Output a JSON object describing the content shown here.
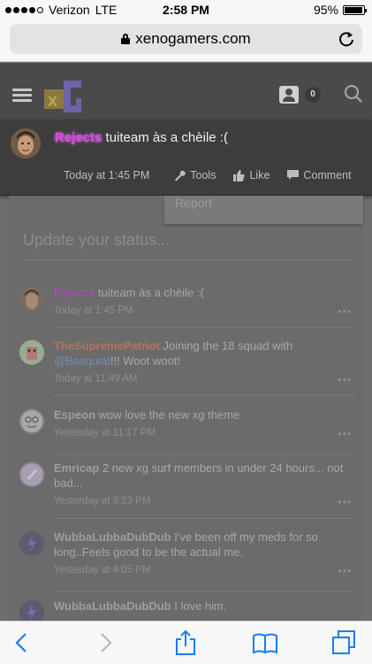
{
  "status_bar": {
    "carrier": "Verizon",
    "network": "LTE",
    "time": "2:58 PM",
    "battery": "95%"
  },
  "browser": {
    "url": "xenogamers.com"
  },
  "header": {
    "notification_count": "0"
  },
  "highlighted_status": {
    "username": "Rejects",
    "message": "tuiteam às a chèile :(",
    "time": "Today at 1:45 PM",
    "tools_label": "Tools",
    "like_label": "Like",
    "comment_label": "Comment"
  },
  "dropdown": {
    "report_label": "Report"
  },
  "status_input": {
    "placeholder": "Update your status..."
  },
  "feed": [
    {
      "username": "Rejects",
      "message": "tuiteam às a chèile :(",
      "time": "Today at 1:45 PM"
    },
    {
      "username": "TheSupremePatriot",
      "message_pre": "Joining the 18 squad with",
      "mention": "@Basquiat",
      "message_post": "!!! Woot woot!",
      "time": "Today at 11:49 AM"
    },
    {
      "username": "Espeon",
      "message": "wow love the new xg theme",
      "time": "Yesterday at 11:17 PM"
    },
    {
      "username": "Emricap",
      "message": "2 new xg surf members in under 24 hours... not bad...",
      "time": "Yesterday at 8:23 PM"
    },
    {
      "username": "WubbaLubbaDubDub",
      "message": "I've been off my meds for so long..Feels good to be the actual me.",
      "time": "Yesterday at 4:05 PM"
    },
    {
      "username": "WubbaLubbaDubDub",
      "message": "I love him."
    }
  ],
  "more_glyph": "•••",
  "colors": {
    "rejects_name": "#d946ef",
    "patriot_name": "#c0785a",
    "mention": "#6d8fb0",
    "ios_blue": "#1a7cf5"
  }
}
